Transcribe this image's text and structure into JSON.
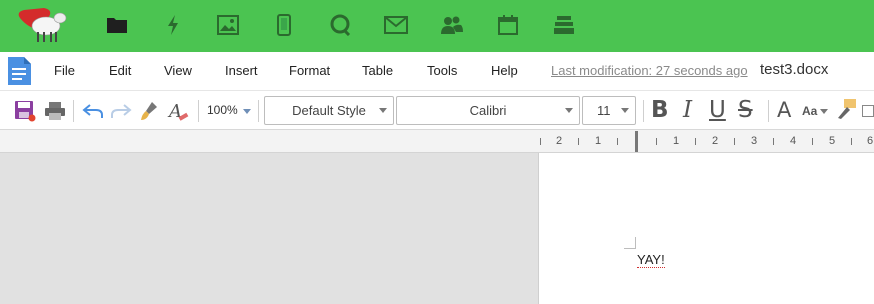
{
  "appbar": {
    "icons": [
      "sheep-logo",
      "folder-icon",
      "lightning-icon",
      "image-icon",
      "phone-icon",
      "chat-icon",
      "mail-icon",
      "contacts-icon",
      "calendar-icon",
      "stack-icon"
    ]
  },
  "menubar": {
    "items": [
      {
        "label": "File"
      },
      {
        "label": "Edit"
      },
      {
        "label": "View"
      },
      {
        "label": "Insert"
      },
      {
        "label": "Format"
      },
      {
        "label": "Table"
      },
      {
        "label": "Tools"
      },
      {
        "label": "Help"
      }
    ],
    "last_modification": "Last modification: 27 seconds ago",
    "filename": "test3.docx"
  },
  "toolbar": {
    "zoom": "100%",
    "paragraph_style": "Default Style",
    "font_name": "Calibri",
    "font_size": "11",
    "bold": "B",
    "italic": "I",
    "underline": "U",
    "strikethrough": "S",
    "font_color": "A",
    "font_size_toggle": "Aa"
  },
  "ruler": {
    "left_numbers": [
      "2",
      "1",
      "1"
    ],
    "right_numbers": [
      "1",
      "2",
      "3",
      "4",
      "5",
      "6"
    ]
  },
  "document": {
    "text": "YAY!"
  },
  "colors": {
    "appbar": "#4bc451",
    "accent_blue": "#4a90e2",
    "save_icon": "#8b3fa0"
  }
}
